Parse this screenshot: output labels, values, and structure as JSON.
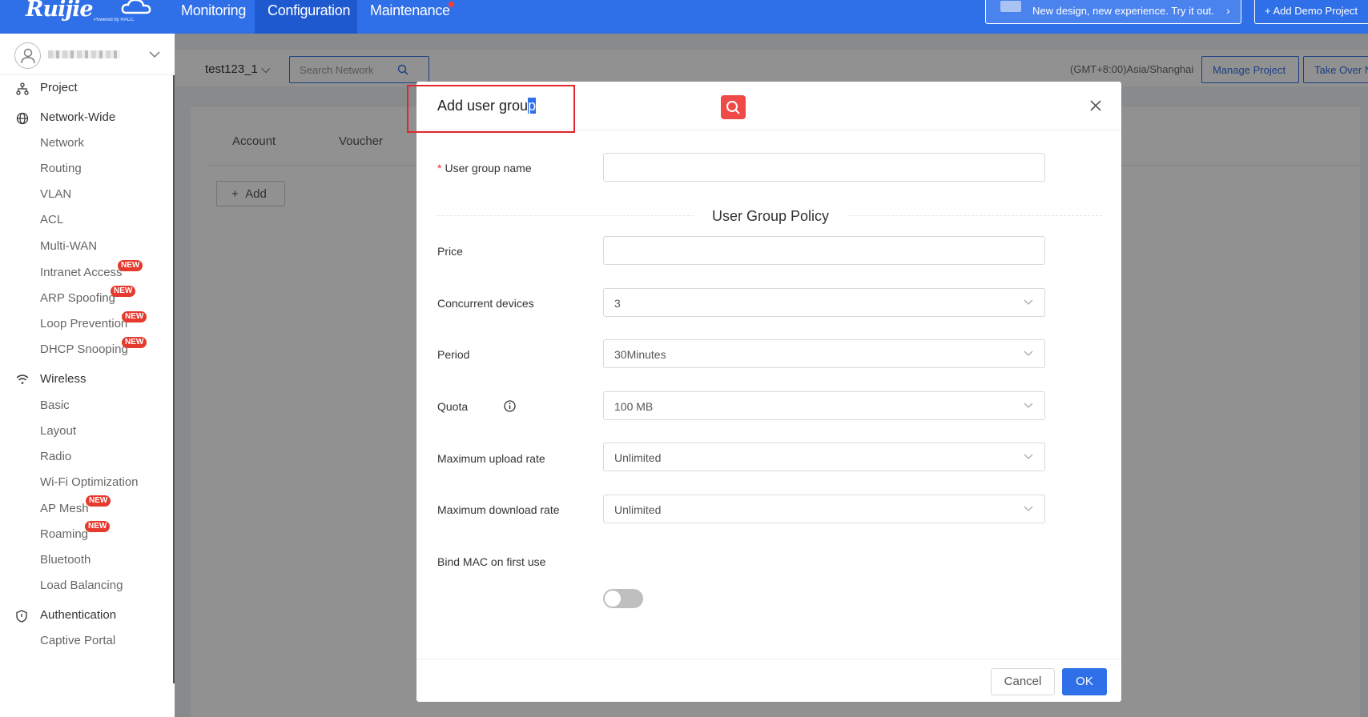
{
  "topbar": {
    "logo_text": "Ruijie",
    "logo_sub": "Powered by RACC",
    "nav": [
      {
        "label": "Monitoring"
      },
      {
        "label": "Configuration"
      },
      {
        "label": "Maintenance"
      }
    ],
    "banner_text": "New design, new experience. Try it out.",
    "demo_button": "+ Add Demo Project",
    "accent_color": "#2f6fe8"
  },
  "sidebar": {
    "groups": [
      {
        "label": "Project",
        "icon": "project-icon"
      },
      {
        "label": "Network-Wide",
        "icon": "globe-icon",
        "items": [
          "Network",
          "Routing",
          "VLAN",
          "ACL",
          "Multi-WAN",
          "Intranet Access",
          "ARP Spoofing",
          "Loop Prevention",
          "DHCP Snooping"
        ]
      },
      {
        "label": "Wireless",
        "icon": "wifi-icon",
        "items": [
          "Basic",
          "Layout",
          "Radio",
          "Wi-Fi Optimization",
          "AP Mesh",
          "Roaming",
          "Bluetooth",
          "Load Balancing"
        ]
      },
      {
        "label": "Authentication",
        "icon": "shield-icon",
        "items": [
          "Captive Portal"
        ]
      }
    ],
    "badge": "NEW"
  },
  "header": {
    "project": "test123_1",
    "search_placeholder": "Search Network",
    "timezone": "(GMT+8:00)Asia/Shanghai",
    "manage_project": "Manage Project",
    "take_over": "Take Over N"
  },
  "content": {
    "tabs": [
      "Account",
      "Voucher"
    ],
    "add_button": "Add"
  },
  "modal": {
    "title_main": "Add user grou",
    "title_selected": "p",
    "fields": {
      "group_name": {
        "label": "User group name",
        "value": ""
      },
      "policy_title": "User Group Policy",
      "price": {
        "label": "Price",
        "value": ""
      },
      "concurrent": {
        "label": "Concurrent devices",
        "value": "3"
      },
      "period": {
        "label": "Period",
        "value": "30Minutes"
      },
      "quota": {
        "label": "Quota",
        "value": "100 MB"
      },
      "upload": {
        "label": "Maximum upload rate",
        "value": "Unlimited"
      },
      "download": {
        "label": "Maximum download rate",
        "value": "Unlimited"
      },
      "bind_mac": {
        "label": "Bind MAC on first use",
        "enabled": false
      }
    },
    "cancel": "Cancel",
    "ok": "OK"
  }
}
